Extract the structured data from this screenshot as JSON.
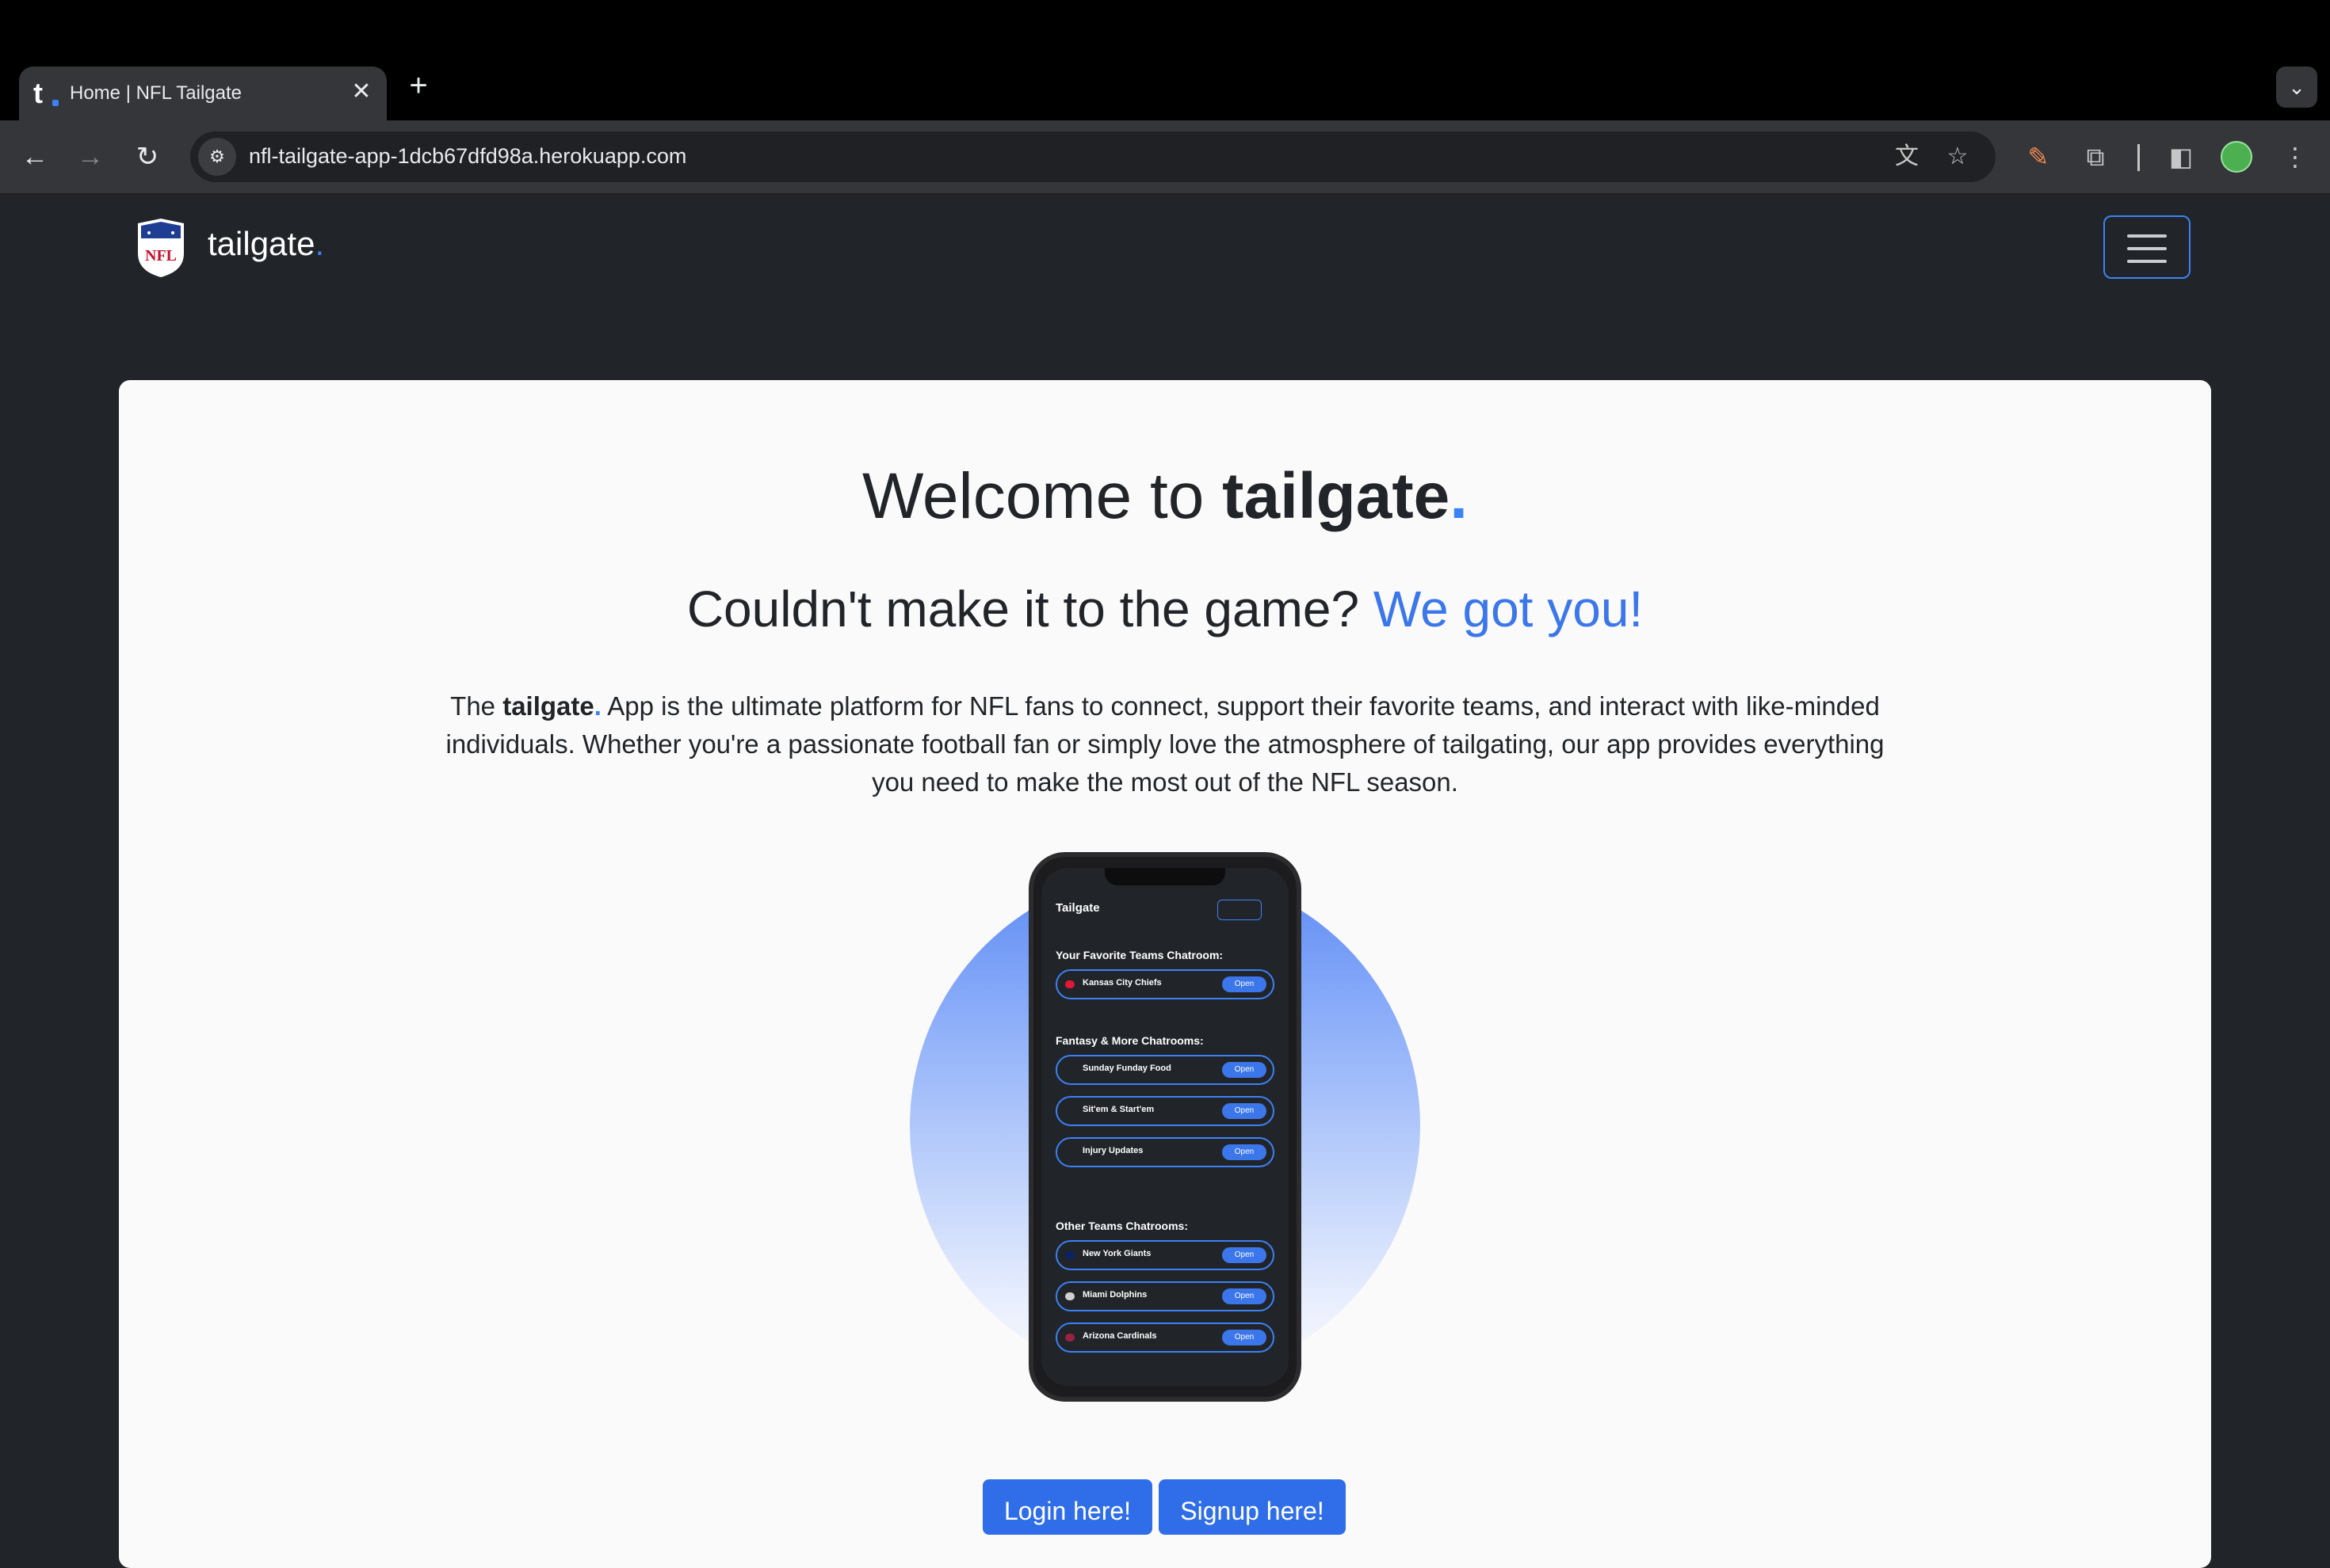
{
  "browser": {
    "tab_title": "Home | NFL Tailgate",
    "url": "nfl-tailgate-app-1dcb67dfd98a.herokuapp.com"
  },
  "navbar": {
    "brand": "tailgate",
    "brand_dot": "."
  },
  "hero": {
    "title_prefix": "Welcome to ",
    "title_brand": "tailgate",
    "title_dot": ".",
    "subtitle": "Couldn't make it to the game? ",
    "subtitle_accent": "We got you!",
    "desc_prefix": "The ",
    "desc_brand": "tailgate",
    "desc_dot": ".",
    "desc_body": " App is the ultimate platform for NFL fans to connect, support their favorite teams, and interact with like-minded individuals. Whether you're a passionate football fan or simply love the atmosphere of tailgating, our app provides everything you need to make the most out of the NFL season."
  },
  "phone": {
    "app_title": "Tailgate",
    "section_favorite": "Your Favorite Teams Chatroom:",
    "favorite": [
      {
        "label": "Kansas City Chiefs",
        "btn": "Open"
      }
    ],
    "section_fantasy": "Fantasy & More Chatrooms:",
    "fantasy": [
      {
        "label": "Sunday Funday Food",
        "btn": "Open"
      },
      {
        "label": "Sit'em & Start'em",
        "btn": "Open"
      },
      {
        "label": "Injury Updates",
        "btn": "Open"
      }
    ],
    "section_other": "Other Teams Chatrooms:",
    "other": [
      {
        "label": "New York Giants",
        "btn": "Open"
      },
      {
        "label": "Miami Dolphins",
        "btn": "Open"
      },
      {
        "label": "Arizona Cardinals",
        "btn": "Open"
      }
    ]
  },
  "actions": {
    "login": "Login here!",
    "signup": "Signup here!"
  },
  "colors": {
    "accent": "#3b76ea",
    "page_bg": "#212529",
    "card_bg": "#fafafa"
  }
}
